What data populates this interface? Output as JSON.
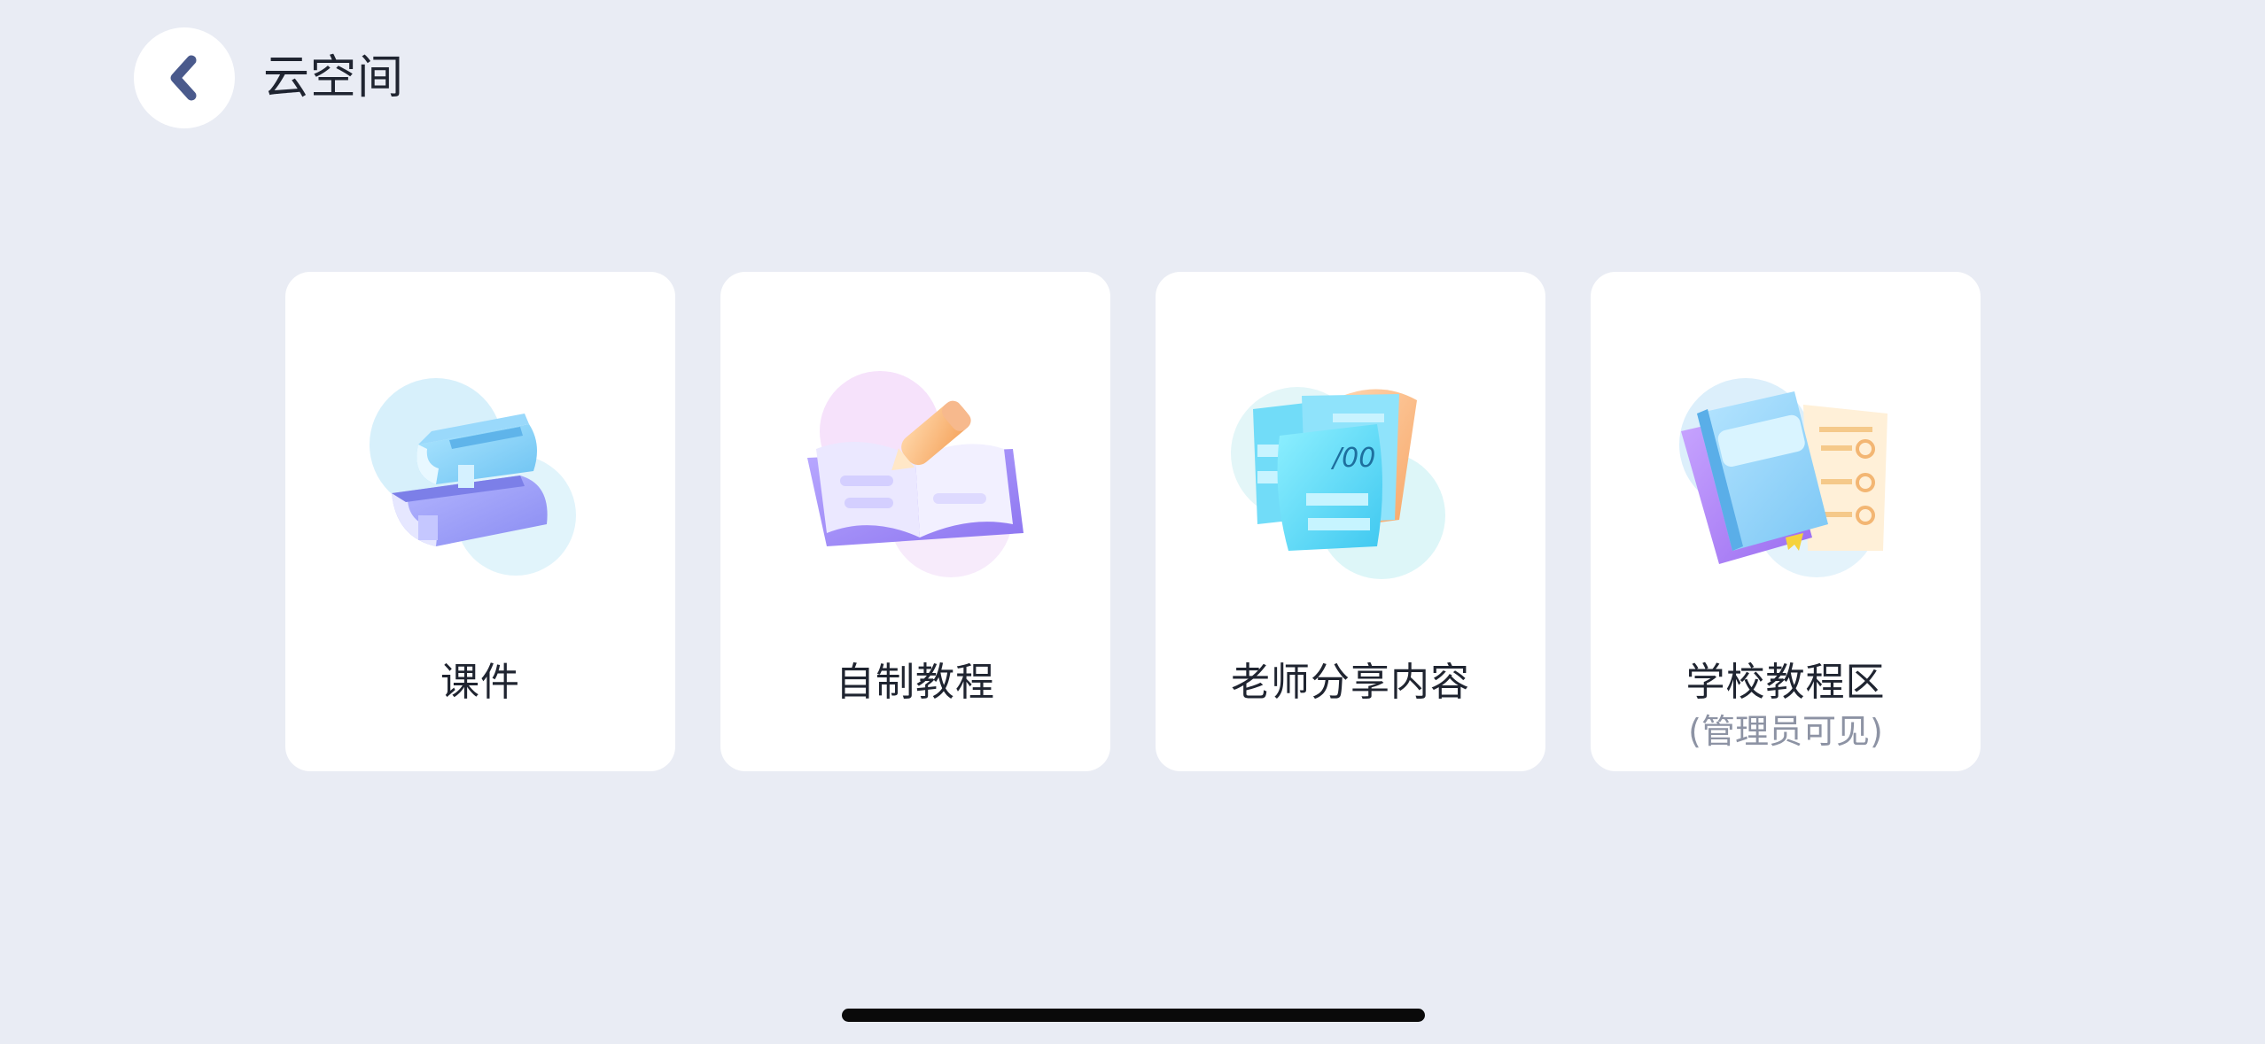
{
  "header": {
    "back_icon": "chevron-left-icon",
    "title": "云空间"
  },
  "cards": [
    {
      "label": "课件",
      "sublabel": "",
      "icon": "stacked-books-icon"
    },
    {
      "label": "自制教程",
      "sublabel": "",
      "icon": "open-book-pencil-icon"
    },
    {
      "label": "老师分享内容",
      "sublabel": "",
      "icon": "shared-papers-icon"
    },
    {
      "label": "学校教程区",
      "sublabel": "(管理员可见)",
      "icon": "school-book-checklist-icon"
    }
  ],
  "colors": {
    "background": "#e9ecf4",
    "card": "#ffffff",
    "back_icon": "#4a5a8c",
    "text_primary": "#1f2430",
    "text_secondary": "#8d93a4",
    "home_indicator": "#0a0a0a"
  }
}
